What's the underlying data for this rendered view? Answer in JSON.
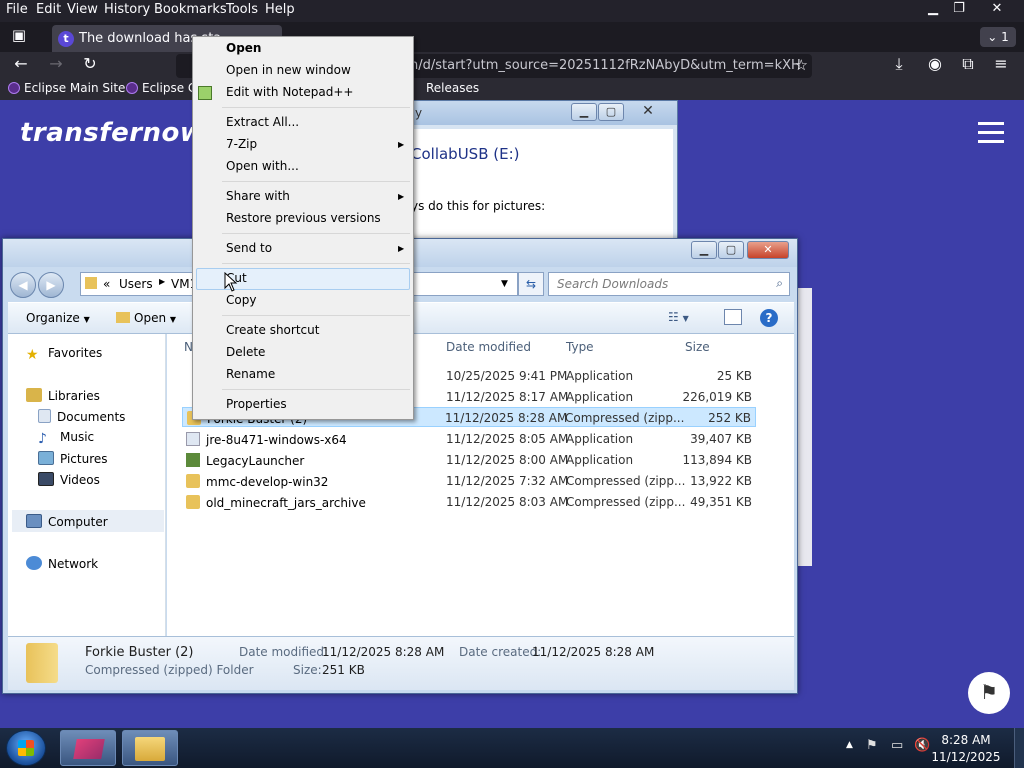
{
  "firefox": {
    "menu": [
      "File",
      "Edit",
      "View",
      "History",
      "Bookmarks",
      "Tools",
      "Help"
    ],
    "window_controls": {
      "minimize": "▁",
      "restore": "❐",
      "close": "✕"
    },
    "tab_title": "The download has sta",
    "tab_count": "1",
    "url": "n/d/start?utm_source=20251112fRzNAbyD&utm_term=kXH",
    "bookmarks": [
      "Eclipse Main Site",
      "Eclipse C",
      "Releases"
    ]
  },
  "page": {
    "brand": "transfernow"
  },
  "autoplay_window": {
    "drive_label": "CollabUSB (E:)",
    "snippet": "ys do this for pictures:",
    "title_snippet": "y"
  },
  "explorer": {
    "breadcrumb": [
      "Users",
      "VM1"
    ],
    "search_placeholder": "Search Downloads",
    "toolbar": {
      "organize": "Organize",
      "open": "Open"
    },
    "nav": {
      "favorites": "Favorites",
      "libraries": "Libraries",
      "documents": "Documents",
      "music": "Music",
      "pictures": "Pictures",
      "videos": "Videos",
      "computer": "Computer",
      "network": "Network"
    },
    "columns": {
      "name": "N",
      "date": "Date modified",
      "type": "Type",
      "size": "Size"
    },
    "rows": [
      {
        "name": "",
        "date": "10/25/2025 9:41 PM",
        "type": "Application",
        "size": "25 KB"
      },
      {
        "name": "",
        "date": "11/12/2025 8:17 AM",
        "type": "Application",
        "size": "226,019 KB"
      },
      {
        "name": "Forkie Buster (2)",
        "date": "11/12/2025 8:28 AM",
        "type": "Compressed (zipp...",
        "size": "252 KB"
      },
      {
        "name": "jre-8u471-windows-x64",
        "date": "11/12/2025 8:05 AM",
        "type": "Application",
        "size": "39,407 KB"
      },
      {
        "name": "LegacyLauncher",
        "date": "11/12/2025 8:00 AM",
        "type": "Application",
        "size": "113,894 KB"
      },
      {
        "name": "mmc-develop-win32",
        "date": "11/12/2025 7:32 AM",
        "type": "Compressed (zipp...",
        "size": "13,922 KB"
      },
      {
        "name": "old_minecraft_jars_archive",
        "date": "11/12/2025 8:03 AM",
        "type": "Compressed (zipp...",
        "size": "49,351 KB"
      }
    ],
    "details": {
      "name": "Forkie Buster (2)",
      "kind": "Compressed (zipped) Folder",
      "date_modified_label": "Date modified:",
      "date_modified": "11/12/2025 8:28 AM",
      "size_label": "Size:",
      "size": "251 KB",
      "date_created_label": "Date created:",
      "date_created": "11/12/2025 8:28 AM"
    }
  },
  "context_menu": {
    "open": "Open",
    "open_new_window": "Open in new window",
    "edit_notepad": "Edit with Notepad++",
    "extract_all": "Extract All...",
    "seven_zip": "7-Zip",
    "open_with": "Open with...",
    "share_with": "Share with",
    "restore_versions": "Restore previous versions",
    "send_to": "Send to",
    "cut": "Cut",
    "copy": "Copy",
    "create_shortcut": "Create shortcut",
    "delete": "Delete",
    "rename": "Rename",
    "properties": "Properties"
  },
  "taskbar": {
    "time": "8:28 AM",
    "date": "11/12/2025"
  },
  "colors": {
    "page_bg": "#3d3ea8",
    "firefox_dark": "#23222b",
    "selection": "#cce8ff"
  }
}
